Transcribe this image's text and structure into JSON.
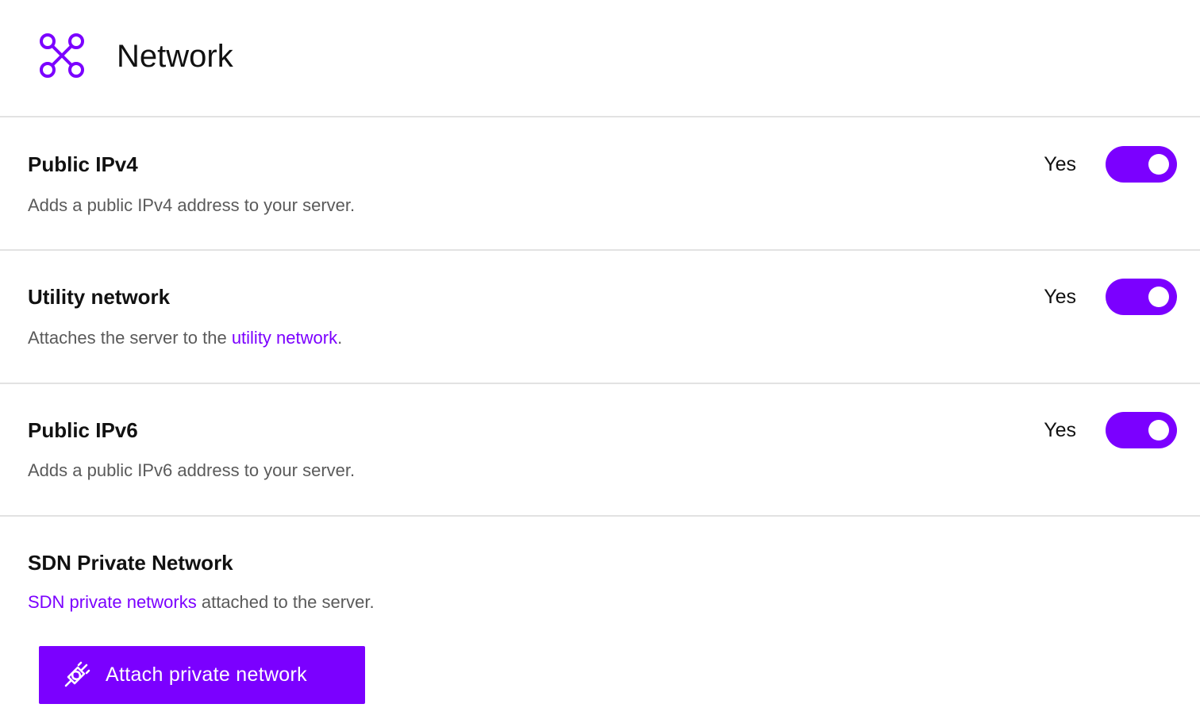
{
  "header": {
    "title": "Network",
    "icon": "network-icon",
    "accent": "#7b00ff"
  },
  "options": [
    {
      "title": "Public IPv4",
      "description": "Adds a public IPv4 address to your server.",
      "toggle_label": "Yes",
      "enabled": true
    },
    {
      "title": "Utility network",
      "description_before": "Attaches the server to the ",
      "description_link": "utility network",
      "description_after": ".",
      "toggle_label": "Yes",
      "enabled": true
    },
    {
      "title": "Public IPv6",
      "description": "Adds a public IPv6 address to your server.",
      "toggle_label": "Yes",
      "enabled": true
    }
  ],
  "sdn": {
    "title": "SDN Private Network",
    "description_link": "SDN private networks",
    "description_after": " attached to the server.",
    "button_label": "Attach private network",
    "button_icon": "plug-icon"
  },
  "colors": {
    "accent": "#7b00ff",
    "divider": "#e2e2e2",
    "muted_text": "#5a5a5a"
  }
}
